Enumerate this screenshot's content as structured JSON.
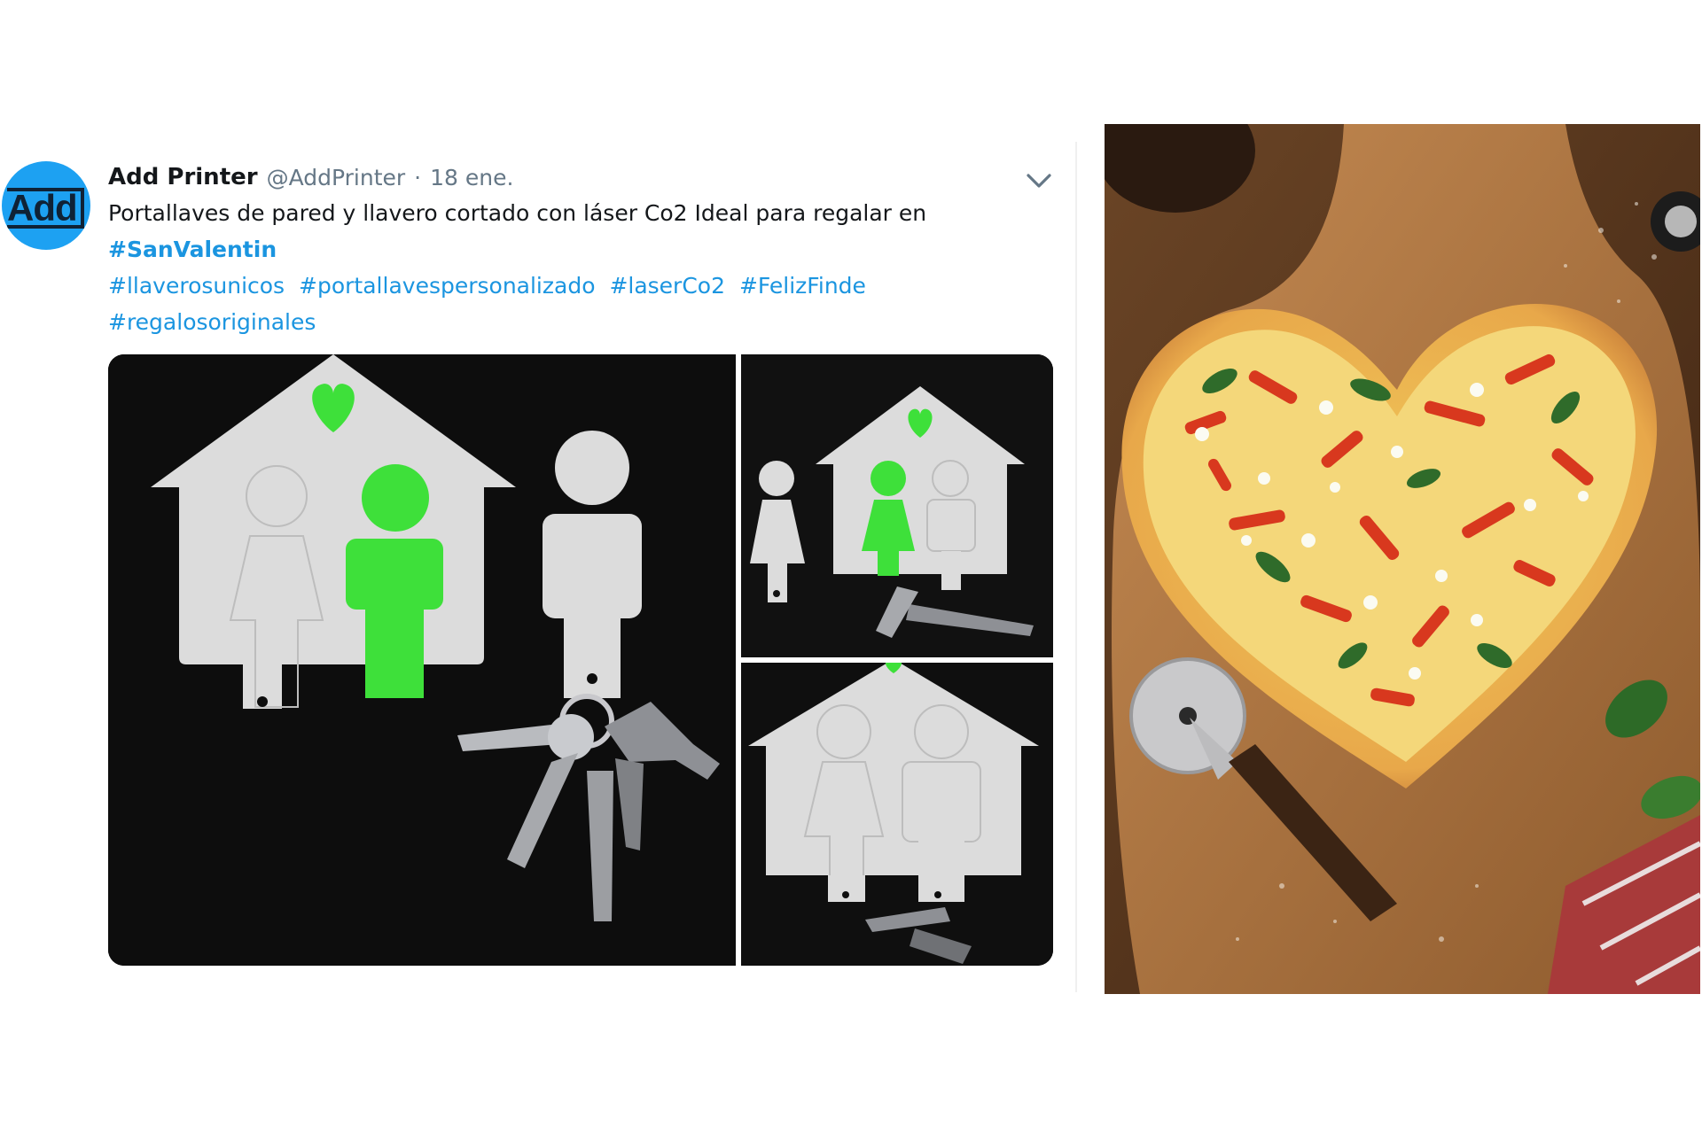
{
  "tweet": {
    "author_name": "Add Printer",
    "author_handle": "@AddPrinter",
    "separator": "·",
    "date": "18 ene.",
    "avatar_logo_text": "Add",
    "text": "Portallaves de pared y llavero cortado con láser Co2 Ideal para regalar en",
    "hashtags_line1": [
      "#SanValentin"
    ],
    "hashtags_line2": [
      "#llaverosunicos",
      "#portallavespersonalizado",
      "#laserCo2",
      "#FelizFinde"
    ],
    "hashtags_line3": [
      "#regalosoriginales"
    ],
    "menu_icon": "chevron-down-icon",
    "link_color": "#1b95e0",
    "avatar_color": "#1da1f2"
  },
  "media": {
    "images": [
      {
        "subject": "white house-shaped key holder with green heart and figure cutouts, keys hanging"
      },
      {
        "subject": "house key holder with small figure keychain on the left"
      },
      {
        "subject": "house key holder with two figures and keys"
      }
    ],
    "accent_color": "#3ee03a"
  },
  "photo": {
    "subject": "heart-shaped pizza on a wooden board with a pizza cutter"
  }
}
